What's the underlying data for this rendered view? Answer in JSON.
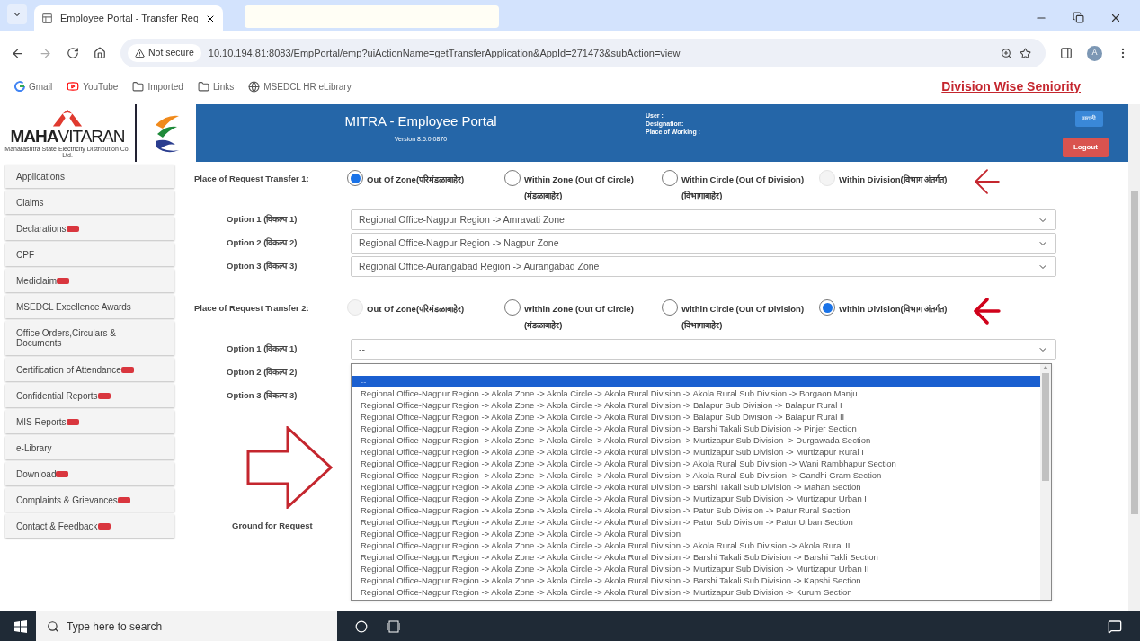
{
  "browser": {
    "tab_title": "Employee Portal - Transfer Req",
    "security": "Not secure",
    "url": "10.10.194.81:8083/EmpPortal/emp?uiActionName=getTransferApplication&AppId=271473&subAction=view",
    "avatar": "A",
    "bookmarks": [
      {
        "label": "Gmail",
        "kind": "google"
      },
      {
        "label": "YouTube",
        "kind": "youtube"
      },
      {
        "label": "Imported",
        "kind": "folder"
      },
      {
        "label": "Links",
        "kind": "folder"
      },
      {
        "label": "MSEDCL HR eLibrary",
        "kind": "globe"
      }
    ]
  },
  "top_link": "Division Wise Seniority",
  "header": {
    "logo": "**MAHA**VITARAN",
    "logo_sub": "Maharashtra State Electricity Distribution Co. Ltd.",
    "title": "MITRA - Employee Portal",
    "version": "Version 8.5.0.0870",
    "user_lines": [
      "User :",
      "Designation:",
      "Place of Working :"
    ],
    "language_button": "मराठी",
    "logout": "Logout"
  },
  "sidebar": [
    {
      "label": "Applications",
      "new": false
    },
    {
      "label": "Claims",
      "new": false
    },
    {
      "label": "Declarations",
      "new": true
    },
    {
      "label": "CPF",
      "new": false
    },
    {
      "label": "Mediclaim",
      "new": true
    },
    {
      "label": "MSEDCL Excellence Awards",
      "new": false
    },
    {
      "label": "Office Orders,Circulars & Documents",
      "new": false
    },
    {
      "label": "Certification of Attendance",
      "new": true
    },
    {
      "label": "Confidential Reports",
      "new": true
    },
    {
      "label": "MIS Reports",
      "new": true
    },
    {
      "label": "e-Library",
      "new": false
    },
    {
      "label": "Download",
      "new": true
    },
    {
      "label": "Complaints & Grievances",
      "new": true
    },
    {
      "label": "Contact & Feedback",
      "new": true
    }
  ],
  "transfers": [
    {
      "label": "Place of Request Transfer 1:",
      "radios": [
        {
          "label": "Out Of Zone(परिमंडळाबाहेर)",
          "selected": true,
          "disabled": false
        },
        {
          "label": "Within Zone (Out Of Circle) (मंडळाबाहेर)",
          "selected": false,
          "disabled": false
        },
        {
          "label": "Within Circle (Out Of Division)(विभागाबाहेर)",
          "selected": false,
          "disabled": false
        },
        {
          "label": "Within Division(विभाग अंतर्गत)",
          "selected": false,
          "disabled": true
        }
      ],
      "options": [
        {
          "label": "Option 1 (विकल्प 1)",
          "value": "Regional Office-Nagpur Region -> Amravati Zone"
        },
        {
          "label": "Option 2 (विकल्प 2)",
          "value": "Regional Office-Nagpur Region -> Nagpur Zone"
        },
        {
          "label": "Option 3 (विकल्प 3)",
          "value": "Regional Office-Aurangabad Region -> Aurangabad Zone"
        }
      ]
    },
    {
      "label": "Place of Request Transfer 2:",
      "radios": [
        {
          "label": "Out Of Zone(परिमंडळाबाहेर)",
          "selected": false,
          "disabled": true
        },
        {
          "label": "Within Zone (Out Of Circle) (मंडळाबाहेर)",
          "selected": false,
          "disabled": false
        },
        {
          "label": "Within Circle (Out Of Division)(विभागाबाहेर)",
          "selected": false,
          "disabled": false
        },
        {
          "label": "Within Division(विभाग अंतर्गत)",
          "selected": true,
          "disabled": false
        }
      ],
      "options": [
        {
          "label": "Option 1 (विकल्प 1)",
          "value": "--"
        },
        {
          "label": "Option 2 (विकल्प 2)"
        },
        {
          "label": "Option 3 (विकल्प 3)"
        }
      ]
    }
  ],
  "dropdown": [
    {
      "text": "--",
      "selected": true
    },
    {
      "text": "Regional Office-Nagpur Region -> Akola Zone -> Akola Circle -> Akola Rural Division -> Akola Rural Sub Division -> Borgaon Manju",
      "selected": false
    },
    {
      "text": "Regional Office-Nagpur Region -> Akola Zone -> Akola Circle -> Akola Rural Division -> Balapur Sub Division -> Balapur Rural I",
      "selected": false
    },
    {
      "text": "Regional Office-Nagpur Region -> Akola Zone -> Akola Circle -> Akola Rural Division -> Balapur Sub Division -> Balapur Rural II",
      "selected": false
    },
    {
      "text": "Regional Office-Nagpur Region -> Akola Zone -> Akola Circle -> Akola Rural Division -> Barshi Takali Sub Division -> Pinjer Section",
      "selected": false
    },
    {
      "text": "Regional Office-Nagpur Region -> Akola Zone -> Akola Circle -> Akola Rural Division -> Murtizapur Sub Division -> Durgawada Section",
      "selected": false
    },
    {
      "text": "Regional Office-Nagpur Region -> Akola Zone -> Akola Circle -> Akola Rural Division -> Murtizapur Sub Division -> Murtizapur Rural I",
      "selected": false
    },
    {
      "text": "Regional Office-Nagpur Region -> Akola Zone -> Akola Circle -> Akola Rural Division -> Akola Rural Sub Division -> Wani Rambhapur Section",
      "selected": false
    },
    {
      "text": "Regional Office-Nagpur Region -> Akola Zone -> Akola Circle -> Akola Rural Division -> Akola Rural Sub Division -> Gandhi Gram Section",
      "selected": false
    },
    {
      "text": "Regional Office-Nagpur Region -> Akola Zone -> Akola Circle -> Akola Rural Division -> Barshi Takali Sub Division -> Mahan Section",
      "selected": false
    },
    {
      "text": "Regional Office-Nagpur Region -> Akola Zone -> Akola Circle -> Akola Rural Division -> Murtizapur Sub Division -> Murtizapur Urban I",
      "selected": false
    },
    {
      "text": "Regional Office-Nagpur Region -> Akola Zone -> Akola Circle -> Akola Rural Division -> Patur Sub Division -> Patur Rural Section",
      "selected": false
    },
    {
      "text": "Regional Office-Nagpur Region -> Akola Zone -> Akola Circle -> Akola Rural Division -> Patur Sub Division -> Patur Urban Section",
      "selected": false
    },
    {
      "text": "Regional Office-Nagpur Region -> Akola Zone -> Akola Circle -> Akola Rural Division",
      "selected": false
    },
    {
      "text": "Regional Office-Nagpur Region -> Akola Zone -> Akola Circle -> Akola Rural Division -> Akola Rural Sub Division -> Akola Rural II",
      "selected": false
    },
    {
      "text": "Regional Office-Nagpur Region -> Akola Zone -> Akola Circle -> Akola Rural Division -> Barshi Takali Sub Division -> Barshi Takli Section",
      "selected": false
    },
    {
      "text": "Regional Office-Nagpur Region -> Akola Zone -> Akola Circle -> Akola Rural Division -> Murtizapur Sub Division -> Murtizapur Urban II",
      "selected": false
    },
    {
      "text": "Regional Office-Nagpur Region -> Akola Zone -> Akola Circle -> Akola Rural Division -> Barshi Takali Sub Division -> Kapshi Section",
      "selected": false
    },
    {
      "text": "Regional Office-Nagpur Region -> Akola Zone -> Akola Circle -> Akola Rural Division -> Murtizapur Sub Division -> Kurum Section",
      "selected": false
    }
  ],
  "ground_label": "Ground for Request",
  "taskbar": {
    "search_placeholder": "Type here to search"
  }
}
